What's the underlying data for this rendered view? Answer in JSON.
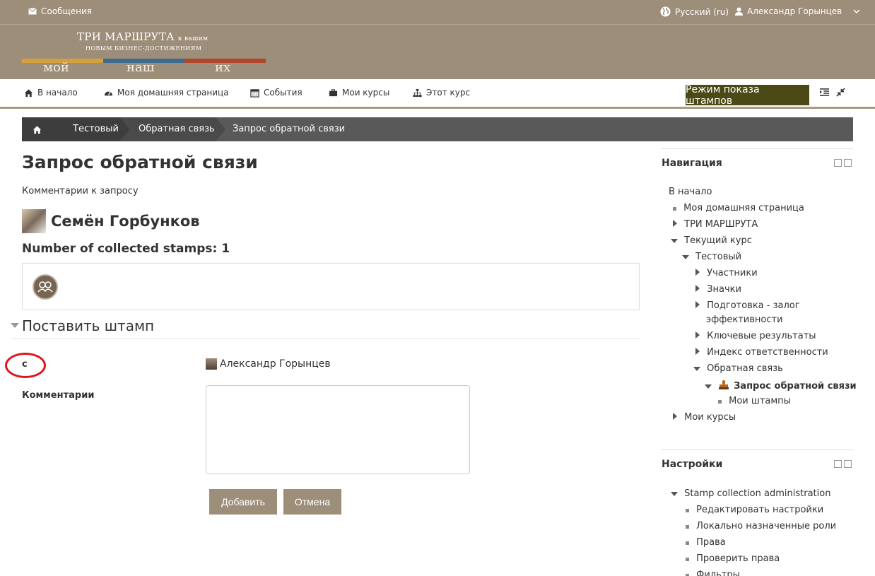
{
  "topbar": {
    "messages": "Сообщения",
    "language": "Русский ‎(ru)‎",
    "user": "Александр Горынцев"
  },
  "logo": {
    "line1": "ТРИ МАРШРУТА",
    "line1_small": "к вашим",
    "line2": "НОВЫМ БИЗНЕС-ДОСТИЖЕНИЯМ",
    "words": [
      "мой",
      "наш",
      "их"
    ]
  },
  "nav": {
    "items": [
      {
        "label": "В начало",
        "icon": "home-icon"
      },
      {
        "label": "Моя домашняя страница",
        "icon": "dashboard-icon"
      },
      {
        "label": "События",
        "icon": "calendar-icon"
      },
      {
        "label": "Мои курсы",
        "icon": "briefcase-icon"
      },
      {
        "label": "Этот курс",
        "icon": "sitemap-icon"
      }
    ],
    "stamp_mode": "Режим показа штампов"
  },
  "breadcrumb": [
    "Тестовый",
    "Обратная связь",
    "Запрос обратной связи"
  ],
  "page": {
    "title": "Запрос обратной связи",
    "subtitle": "Комментарии к запросу",
    "person_name": "Семён Горбунков",
    "stamps_count": "Number of collected stamps: 1",
    "section_title": "Поставить штамп",
    "from_label": "с",
    "from_value": "Александр Горынцев",
    "comments_label": "Комментарии",
    "comments_value": "",
    "add_button": "Добавить",
    "cancel_button": "Отмена"
  },
  "navigation_block": {
    "title": "Навигация",
    "items": [
      "В начало",
      "Моя домашняя страница",
      "ТРИ МАРШРУТА",
      "Текущий курс",
      "Тестовый",
      "Участники",
      "Значки",
      "Подготовка - залог",
      "эффективности",
      "Ключевые результаты",
      "Индекс ответственности",
      "Обратная связь",
      "Запрос обратной связи",
      "Мои штампы",
      "Мои курсы"
    ]
  },
  "settings_block": {
    "title": "Настройки",
    "items": [
      "Stamp collection administration",
      "Редактировать настройки",
      "Локально назначенные роли",
      "Права",
      "Проверить права",
      "Фильтры"
    ]
  },
  "colors": {
    "header": "#9d8e7a",
    "stamp_mode_button": "#4b4a16",
    "breadcrumb": "#595959",
    "highlight_circle": "#e0141b"
  }
}
